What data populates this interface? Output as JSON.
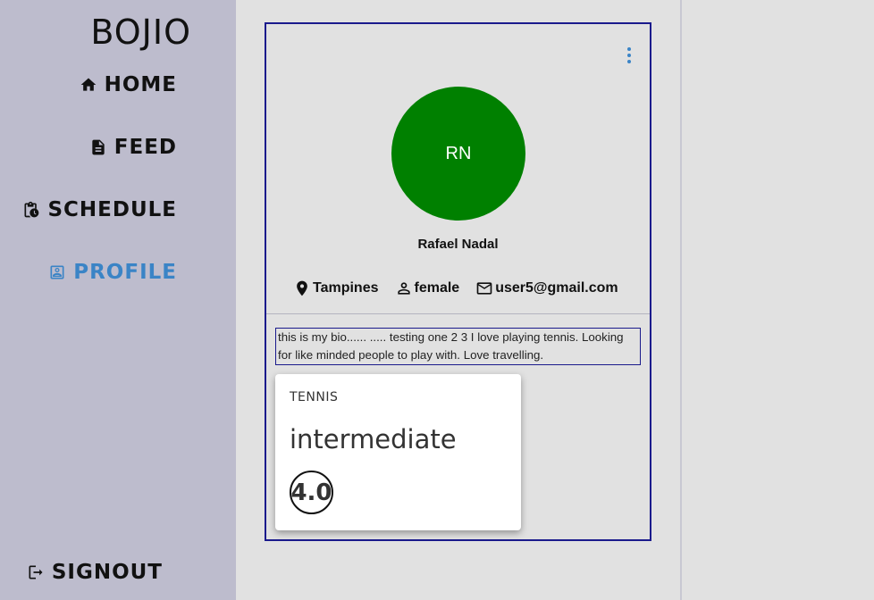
{
  "app": {
    "brand": "BOJIO"
  },
  "nav": {
    "home": {
      "label": "HOME",
      "icon": "home-icon"
    },
    "feed": {
      "label": "FEED",
      "icon": "document-icon"
    },
    "schedule": {
      "label": "SCHEDULE",
      "icon": "clipboard-clock-icon"
    },
    "profile": {
      "label": "PROFILE",
      "icon": "profile-icon",
      "active": true
    },
    "signout": {
      "label": "SIGNOUT",
      "icon": "logout-icon"
    }
  },
  "profile": {
    "initials": "RN",
    "name": "Rafael Nadal",
    "location": "Tampines",
    "gender": "female",
    "email": "user5@gmail.com",
    "bio": "this is my bio...... ..... testing one 2 3 I love playing tennis. Looking for like minded people to play with. Love travelling.",
    "avatar_color": "#008000"
  },
  "sport": {
    "name": "TENNIS",
    "level": "intermediate",
    "rating": "4.0"
  },
  "colors": {
    "sidebar_bg": "#bdbccd",
    "accent": "#3a84c6",
    "card_border": "#1a1a8c",
    "page_bg": "#e1e1e1"
  }
}
